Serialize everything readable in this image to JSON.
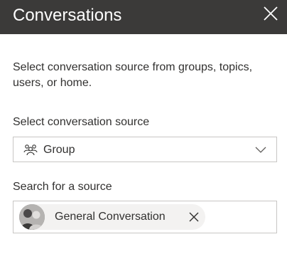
{
  "panel": {
    "title": "Conversations",
    "close_icon": "close-icon",
    "description": "Select conversation source from groups, topics, users, or home.",
    "source": {
      "label": "Select conversation source",
      "selected_value": "Group",
      "icon": "group-icon",
      "chevron_icon": "chevron-down-icon"
    },
    "search": {
      "label": "Search for a source",
      "selected_chip": {
        "text": "General Conversation",
        "avatar_icon": "group-avatar",
        "remove_icon": "close-icon"
      }
    }
  },
  "colors": {
    "header_bg": "#3b3a39",
    "header_text": "#ffffff",
    "body_text": "#323130",
    "border": "#c8c6c4",
    "chip_bg": "#f3f2f1"
  }
}
